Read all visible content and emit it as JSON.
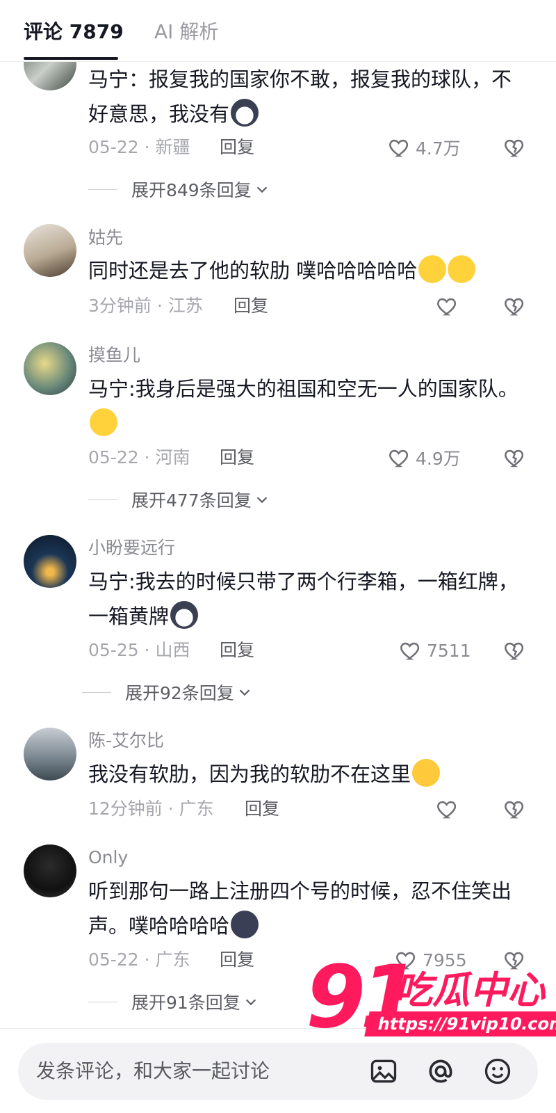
{
  "header": {
    "tab_comments": "评论 7879",
    "tab_ai": "AI 解析"
  },
  "comments": [
    {
      "user": "",
      "text": "马宁：报复我的国家你不敢，报复我的球队，不好意思，我没有",
      "time": "05-22",
      "region": "新疆",
      "reply_label": "回复",
      "likes": "4.7万",
      "expand": "展开849条回复"
    },
    {
      "user": "姑先",
      "text": "同时还是去了他的软肋 噗哈哈哈哈哈",
      "time": "3分钟前",
      "region": "江苏",
      "reply_label": "回复",
      "likes": "",
      "expand": ""
    },
    {
      "user": "摸鱼儿",
      "text": "马宁:我身后是强大的祖国和空无一人的国家队。",
      "time": "05-22",
      "region": "河南",
      "reply_label": "回复",
      "likes": "4.9万",
      "expand": "展开477条回复"
    },
    {
      "user": "小盼要远行",
      "text": "马宁:我去的时候只带了两个行李箱，一箱红牌，一箱黄牌",
      "time": "05-25",
      "region": "山西",
      "reply_label": "回复",
      "likes": "7511",
      "expand": "展开92条回复"
    },
    {
      "user": "陈-艾尔比",
      "text": "我没有软肋，因为我的软肋不在这里",
      "time": "12分钟前",
      "region": "广东",
      "reply_label": "回复",
      "likes": "",
      "expand": ""
    },
    {
      "user": "Only",
      "text": "听到那句一路上注册四个号的时候，忍不住笑出声。噗哈哈哈哈",
      "time": "05-22",
      "region": "广东",
      "reply_label": "回复",
      "likes": "7955",
      "expand": "展开91条回复"
    }
  ],
  "meta_separator": "·",
  "bottom_bar": {
    "placeholder": "发条评论，和大家一起讨论"
  },
  "watermark": {
    "number": "91",
    "name": "吃瓜中心",
    "url": "https://91vip10.com"
  },
  "colors": {
    "text": "#161823",
    "secondary": "#8a8b91",
    "watermark": "#ff1a5e"
  },
  "icons": [
    "heart-outline",
    "broken-heart",
    "image",
    "at-sign",
    "smiley",
    "chevron-down"
  ]
}
